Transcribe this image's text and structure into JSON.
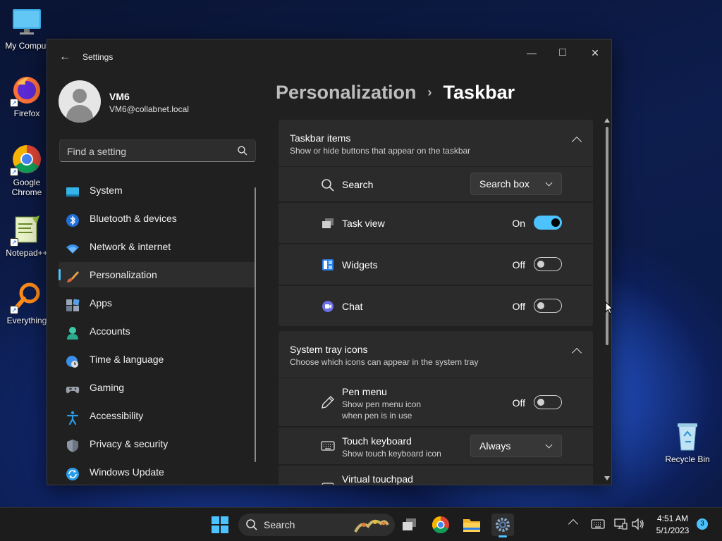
{
  "desktop": {
    "icons": [
      {
        "label": "My Comput",
        "icon": "computer-icon"
      },
      {
        "label": "Firefox",
        "icon": "firefox-icon"
      },
      {
        "label": "Google Chrome",
        "icon": "chrome-icon"
      },
      {
        "label": "Notepad++",
        "icon": "notepad-plus-plus-icon"
      },
      {
        "label": "Everything",
        "icon": "everything-search-icon"
      }
    ],
    "recycle_bin": "Recycle Bin"
  },
  "window": {
    "title": "Settings",
    "back_icon": "←",
    "minimize_icon": "—",
    "maximize_icon": "□",
    "close_icon": "✕"
  },
  "profile": {
    "name": "VM6",
    "email": "VM6@collabnet.local"
  },
  "search": {
    "placeholder": "Find a setting"
  },
  "nav": {
    "items": [
      {
        "label": "System",
        "icon": "system-icon"
      },
      {
        "label": "Bluetooth & devices",
        "icon": "bluetooth-icon"
      },
      {
        "label": "Network & internet",
        "icon": "wifi-icon"
      },
      {
        "label": "Personalization",
        "icon": "brush-icon",
        "active": true
      },
      {
        "label": "Apps",
        "icon": "apps-icon"
      },
      {
        "label": "Accounts",
        "icon": "account-icon"
      },
      {
        "label": "Time & language",
        "icon": "clock-globe-icon"
      },
      {
        "label": "Gaming",
        "icon": "gamepad-icon"
      },
      {
        "label": "Accessibility",
        "icon": "accessibility-icon"
      },
      {
        "label": "Privacy & security",
        "icon": "shield-icon"
      },
      {
        "label": "Windows Update",
        "icon": "update-icon"
      }
    ]
  },
  "breadcrumb": {
    "parent": "Personalization",
    "separator": "›",
    "current": "Taskbar"
  },
  "sections": {
    "taskbar_items": {
      "title": "Taskbar items",
      "subtitle": "Show or hide buttons that appear on the taskbar",
      "rows": {
        "search": {
          "label": "Search",
          "value": "Search box",
          "icon": "search-icon"
        },
        "task_view": {
          "label": "Task view",
          "state": "On",
          "on": true,
          "icon": "task-view-icon"
        },
        "widgets": {
          "label": "Widgets",
          "state": "Off",
          "on": false,
          "icon": "widgets-icon"
        },
        "chat": {
          "label": "Chat",
          "state": "Off",
          "on": false,
          "icon": "chat-icon"
        }
      }
    },
    "system_tray": {
      "title": "System tray icons",
      "subtitle": "Choose which icons can appear in the system tray",
      "rows": {
        "pen_menu": {
          "label": "Pen menu",
          "sub1": "Show pen menu icon",
          "sub2": "when pen is in use",
          "state": "Off",
          "on": false,
          "icon": "pen-icon"
        },
        "touch_keyboard": {
          "label": "Touch keyboard",
          "sub": "Show touch keyboard icon",
          "value": "Always",
          "icon": "keyboard-icon"
        },
        "virtual_touchpad": {
          "label": "Virtual touchpad",
          "icon": "touchpad-icon"
        }
      }
    }
  },
  "taskbar": {
    "search_label": "Search",
    "clock_time": "4:51 AM",
    "clock_date": "5/1/2023",
    "notification_count": "3",
    "colors": {
      "accent": "#4cc2ff",
      "bg": "#1c1c1c"
    }
  }
}
